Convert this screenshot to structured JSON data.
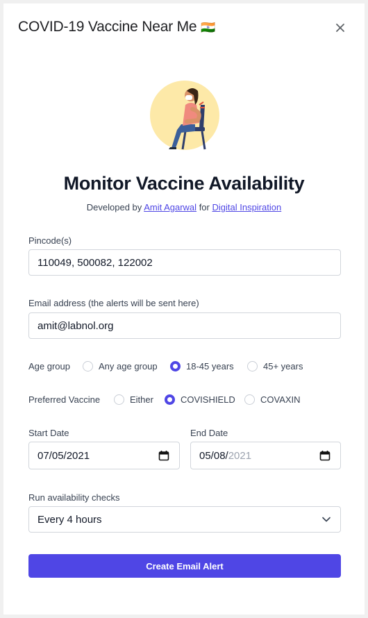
{
  "header": {
    "title": "COVID-19 Vaccine Near Me",
    "flag": "🇮🇳"
  },
  "main": {
    "heading": "Monitor Vaccine Availability",
    "credits": {
      "prefix": "Developed by",
      "author": "Amit Agarwal",
      "middle": "for",
      "org": "Digital Inspiration"
    }
  },
  "form": {
    "pincode": {
      "label": "Pincode(s)",
      "value": "110049, 500082, 122002"
    },
    "email": {
      "label": "Email address (the alerts will be sent here)",
      "value": "amit@labnol.org"
    },
    "age_group": {
      "label": "Age group",
      "options": [
        "Any age group",
        "18-45 years",
        "45+ years"
      ],
      "selected": "18-45 years"
    },
    "vaccine": {
      "label": "Preferred Vaccine",
      "options": [
        "Either",
        "COVISHIELD",
        "COVAXIN"
      ],
      "selected": "COVISHIELD"
    },
    "start_date": {
      "label": "Start Date",
      "value": "07/05/2021"
    },
    "end_date": {
      "label": "End Date",
      "value_main": "05/08/",
      "value_muted": "2021"
    },
    "frequency": {
      "label": "Run availability checks",
      "value": "Every 4 hours"
    },
    "submit_label": "Create Email Alert"
  },
  "colors": {
    "accent": "#4f46e5",
    "illustration_bg": "#fde9a8"
  },
  "icons": [
    "close-icon",
    "calendar-icon",
    "chevron-down-icon",
    "india-flag-icon"
  ]
}
